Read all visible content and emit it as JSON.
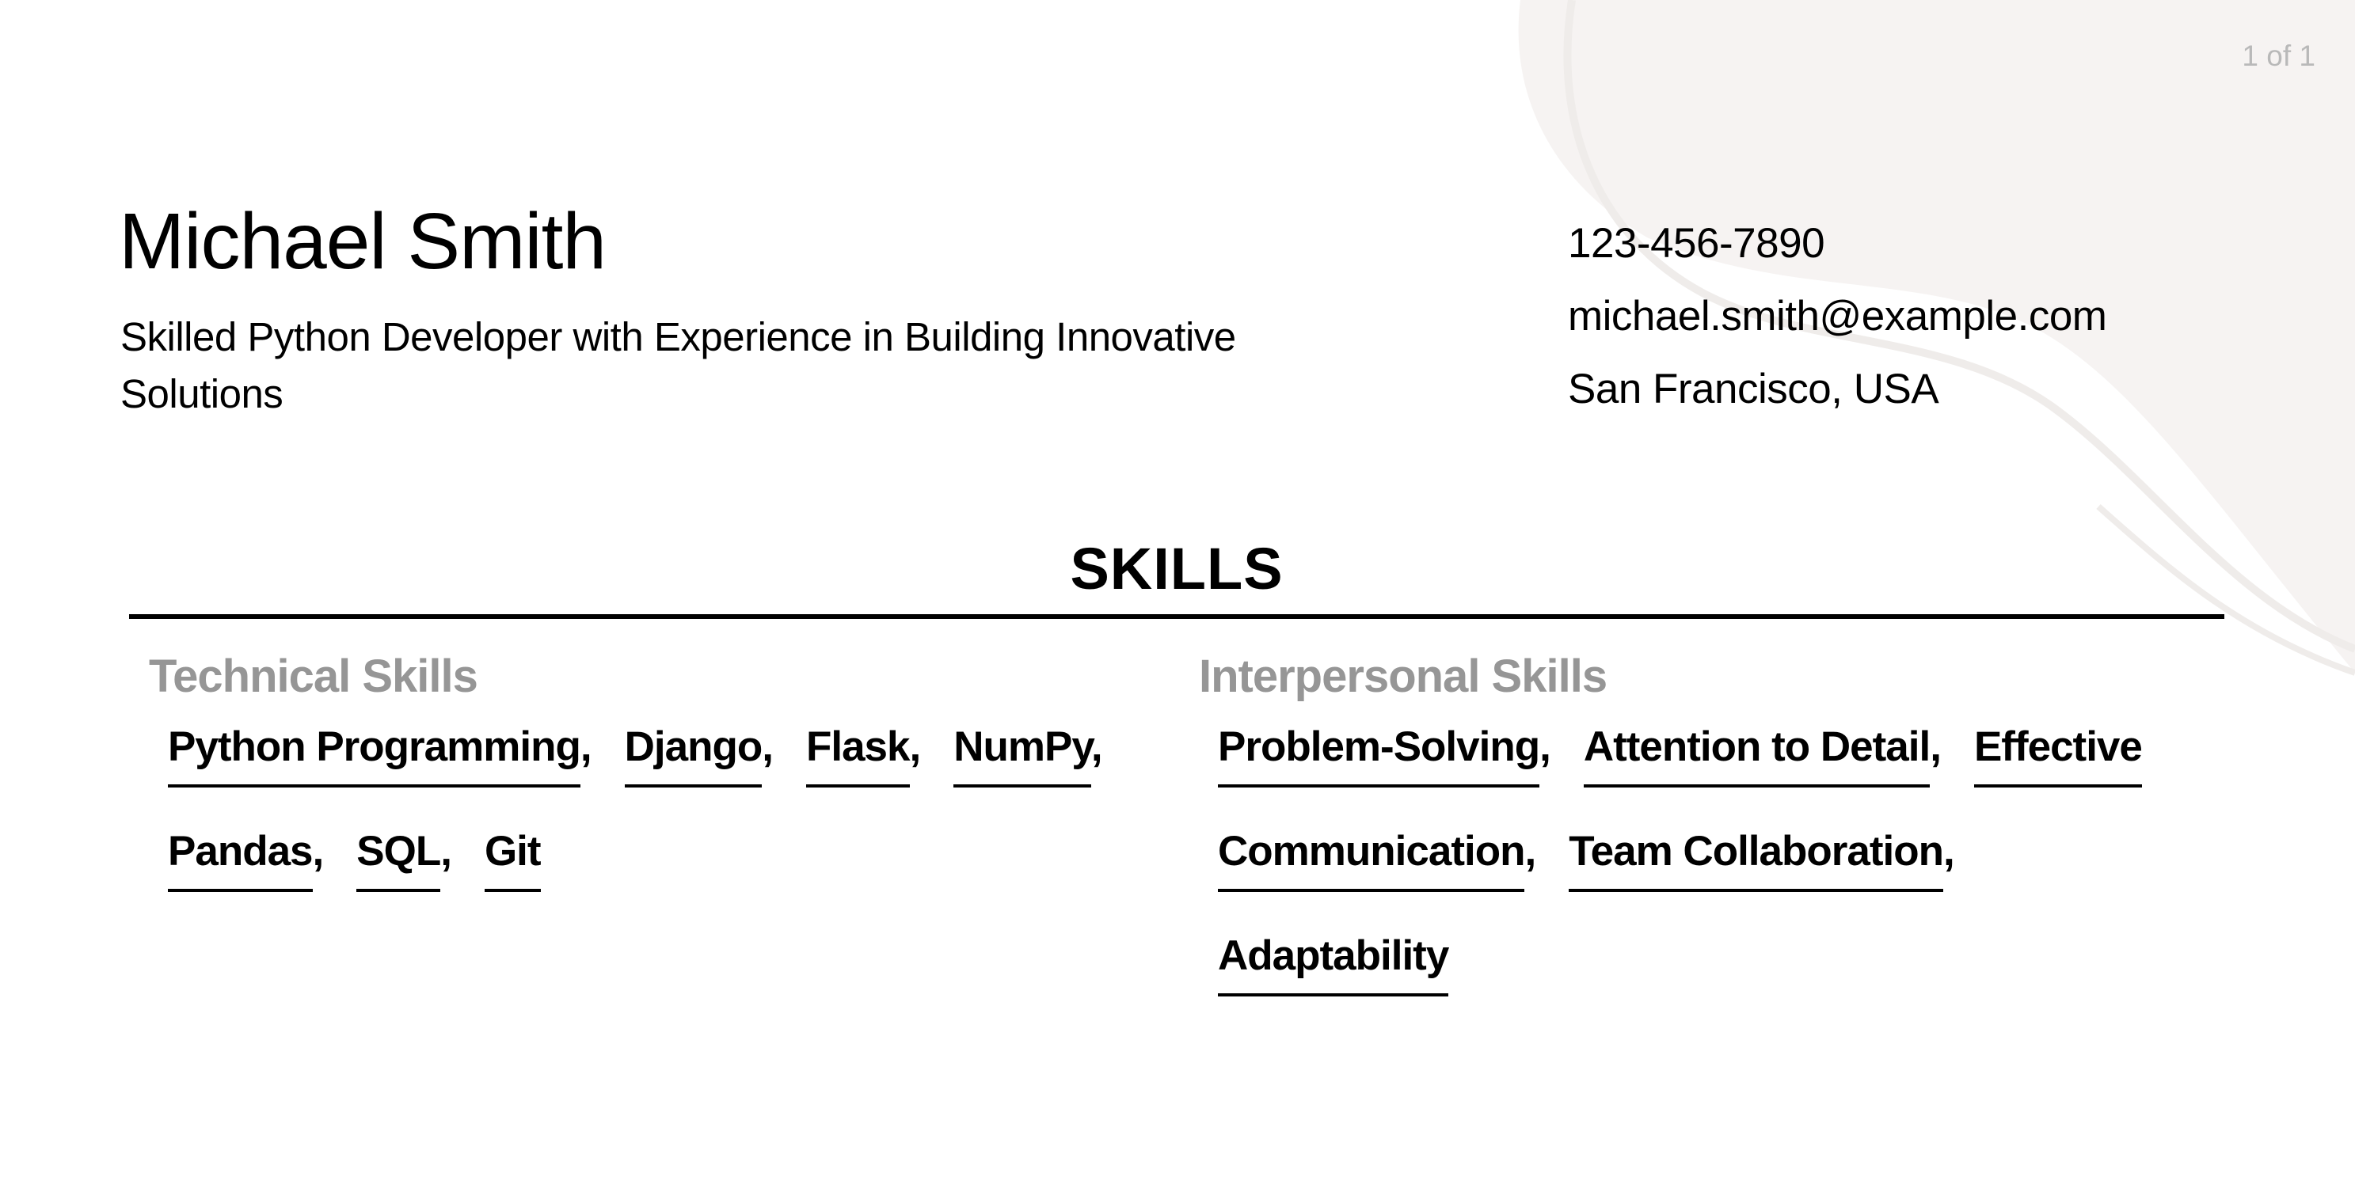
{
  "page_counter": "1 of 1",
  "header": {
    "name": "Michael Smith",
    "tagline": "Skilled Python Developer with Experience in Building Innovative Solutions"
  },
  "contact": {
    "phone": "123-456-7890",
    "email": "michael.smith@example.com",
    "location": "San Francisco, USA"
  },
  "skills": {
    "title": "SKILLS",
    "technical": {
      "heading": "Technical Skills",
      "rows": [
        [
          {
            "label": "Python Programming",
            "sep": ","
          },
          {
            "label": "Django",
            "sep": ","
          },
          {
            "label": "Flask",
            "sep": ","
          },
          {
            "label": "NumPy",
            "sep": ","
          }
        ],
        [
          {
            "label": "Pandas",
            "sep": ","
          },
          {
            "label": "SQL",
            "sep": ","
          },
          {
            "label": "Git",
            "sep": ""
          }
        ]
      ]
    },
    "interpersonal": {
      "heading": "Interpersonal Skills",
      "rows": [
        [
          {
            "label": "Problem-Solving",
            "sep": ","
          },
          {
            "label": "Attention to Detail",
            "sep": ","
          },
          {
            "label": "Effective",
            "sep": ""
          }
        ],
        [
          {
            "label": "Communication",
            "sep": ","
          },
          {
            "label": "Team Collaboration",
            "sep": ","
          }
        ],
        [
          {
            "label": "Adaptability",
            "sep": ""
          }
        ]
      ]
    }
  },
  "colors": {
    "text": "#000000",
    "muted_heading": "#969696",
    "page_counter": "#b9b9b9",
    "decor_fill": "#f6f3f2"
  }
}
